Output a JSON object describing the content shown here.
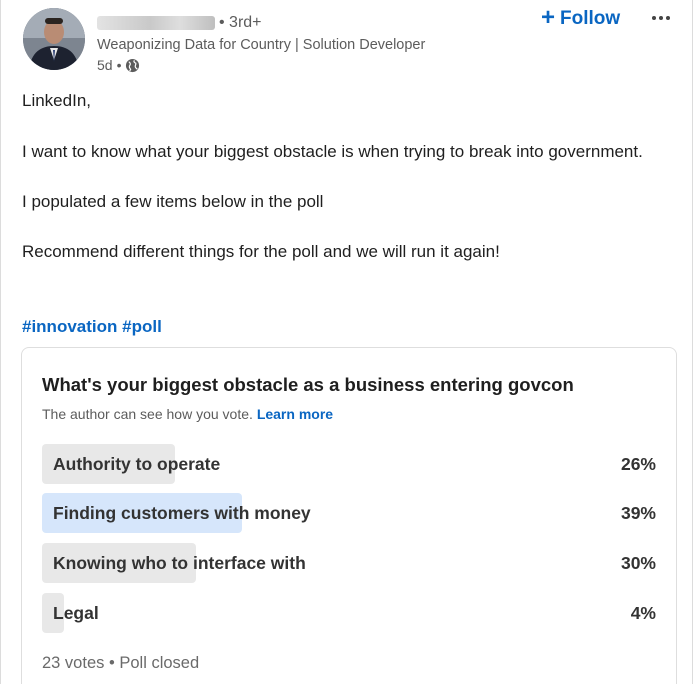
{
  "author": {
    "degree": "• 3rd+",
    "headline": "Weaponizing Data for Country | Solution Developer",
    "time": "5d",
    "visibility_icon": "globe-icon"
  },
  "actions": {
    "follow_label": "Follow",
    "follow_icon": "plus-icon",
    "more_icon": "ellipsis-icon"
  },
  "post": {
    "paragraphs": [
      "LinkedIn,",
      "I want to know what your biggest obstacle is when trying to break into government.",
      "I populated a few items below in the poll",
      "Recommend different things for the poll and we will run it again!"
    ],
    "hashtags": [
      "#innovation",
      "#poll"
    ]
  },
  "poll": {
    "question": "What's your biggest obstacle as a business entering govcon",
    "note": "The author can see how you vote.",
    "learn_more": "Learn more",
    "options": [
      {
        "label": "Authority to operate",
        "percent": "26%",
        "share": 0.26,
        "selected": false
      },
      {
        "label": "Finding customers with money",
        "percent": "39%",
        "share": 0.39,
        "selected": true
      },
      {
        "label": "Knowing who to interface with",
        "percent": "30%",
        "share": 0.3,
        "selected": false
      },
      {
        "label": "Legal",
        "percent": "4%",
        "share": 0.04,
        "selected": false
      }
    ],
    "votes": "23 votes",
    "status": "Poll closed"
  },
  "colors": {
    "accent": "#0a66c2",
    "bar": "#e8e8e8",
    "bar_selected": "#d6e6fb"
  }
}
